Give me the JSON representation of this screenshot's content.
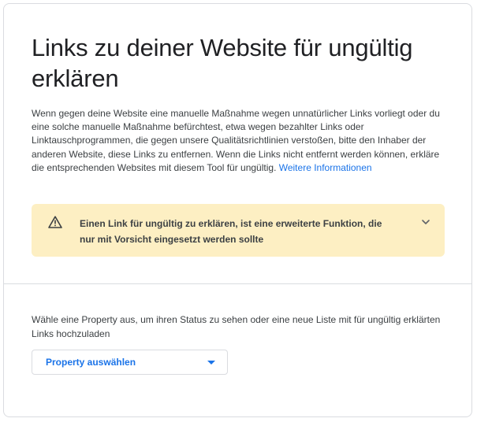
{
  "page": {
    "title": "Links zu deiner Website für ungültig erklären",
    "intro_text": "Wenn gegen deine Website eine manuelle Maßnahme wegen unnatürlicher Links vorliegt oder du eine solche manuelle Maßnahme befürchtest, etwa wegen bezahlter Links oder Linktauschprogrammen, die gegen unsere Qualitätsrichtlinien verstoßen, bitte den Inhaber der anderen Website, diese Links zu entfernen. Wenn die Links nicht entfernt werden können, erkläre die entsprechenden Websites mit diesem Tool für ungültig. ",
    "learn_more_link": "Weitere Informationen"
  },
  "warning": {
    "text": "Einen Link für ungültig zu erklären, ist eine erweiterte Funktion, die nur mit Vorsicht eingesetzt werden sollte",
    "icon": "warning-triangle-icon",
    "expand_icon": "chevron-down-icon"
  },
  "property": {
    "prompt": "Wähle eine Property aus, um ihren Status zu sehen oder eine neue Liste mit für ungültig erklärten Links hochzuladen",
    "select_label": "Property auswählen"
  },
  "colors": {
    "accent": "#1a73e8",
    "warning_background": "#fdefc3",
    "border": "#dadce0"
  }
}
